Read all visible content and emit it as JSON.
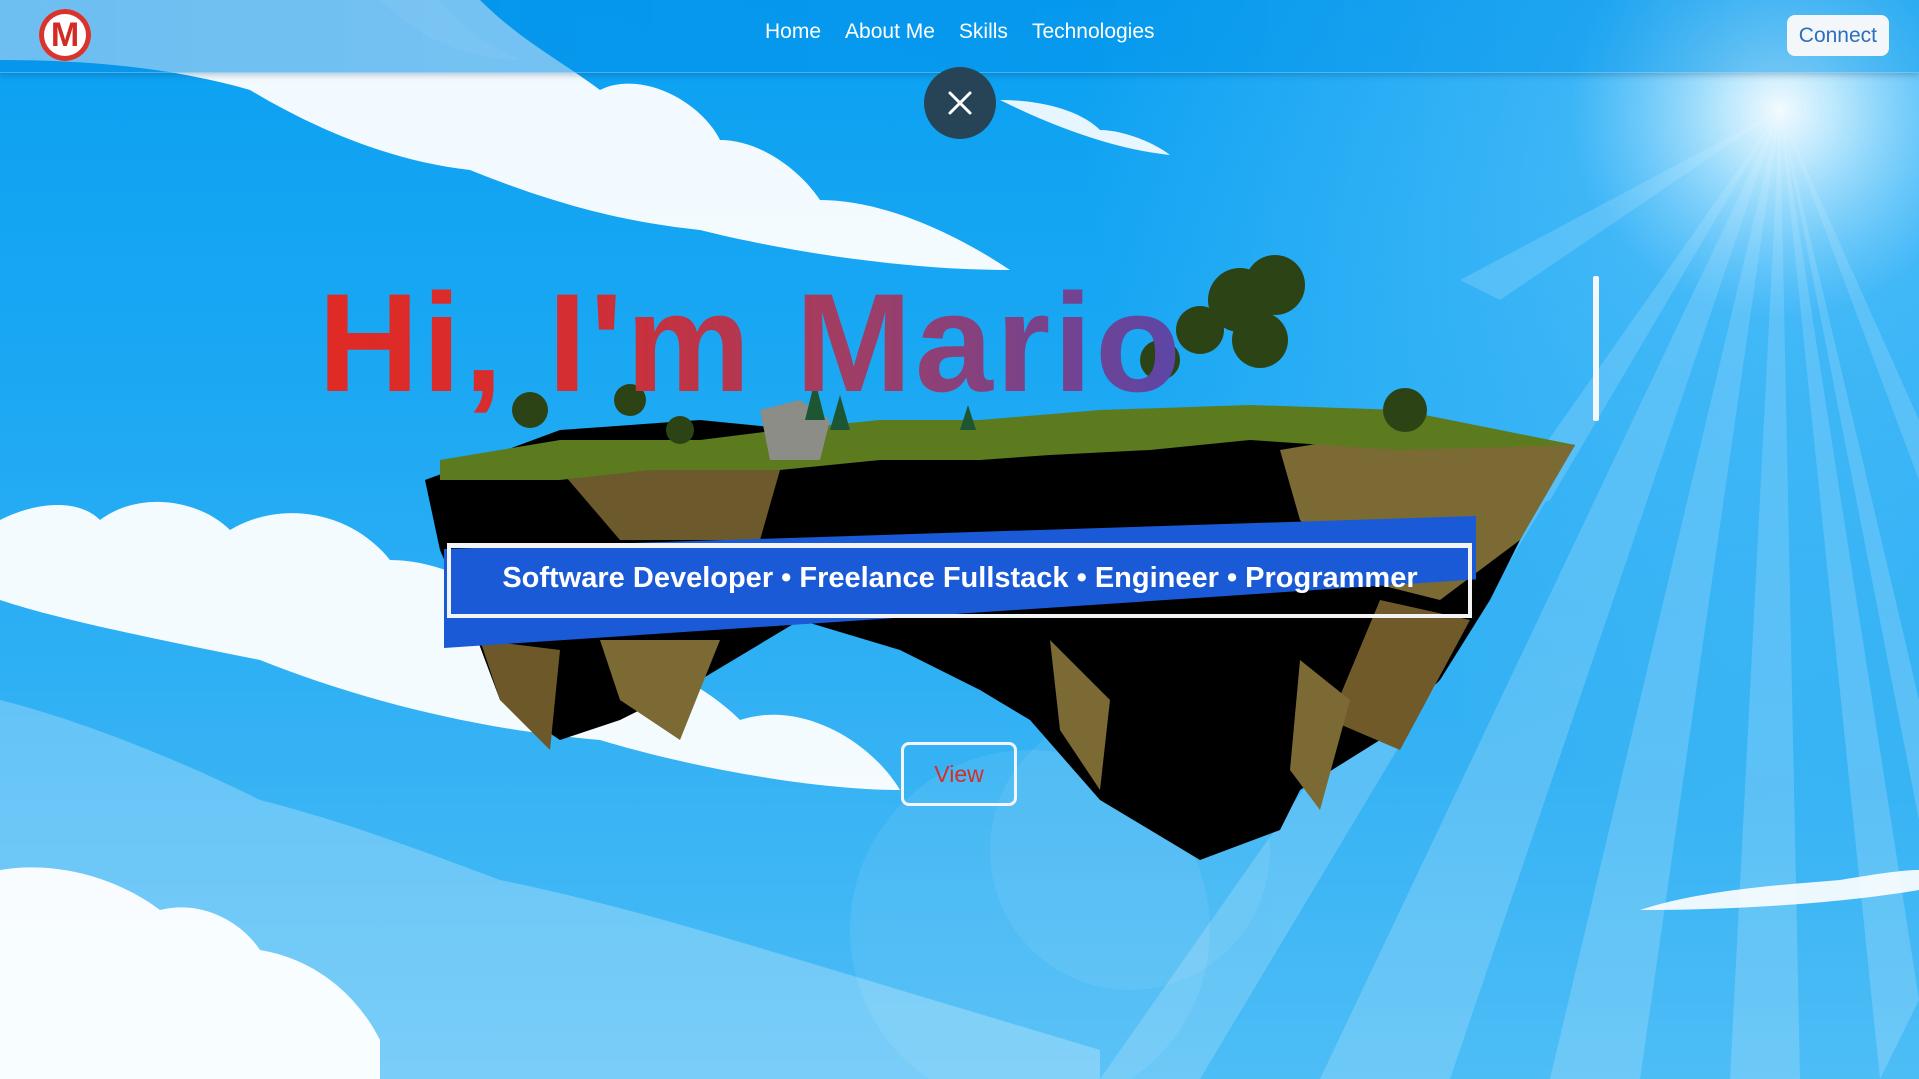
{
  "navbar": {
    "logo_letter": "M",
    "links": [
      "Home",
      "About Me",
      "Skills",
      "Technologies"
    ],
    "connect_label": "Connect"
  },
  "hero": {
    "title": "Hi, I'm Mario",
    "subtitle": "Software Developer • Freelance Fullstack • Engineer • Programmer",
    "view_label": "View"
  },
  "colors": {
    "sky": "#0aa0f2",
    "banner": "#1a5ad6",
    "title_start": "#e12a24",
    "title_end": "#5b46a8",
    "close_button": "#274457",
    "view_text": "#d42d2a"
  }
}
